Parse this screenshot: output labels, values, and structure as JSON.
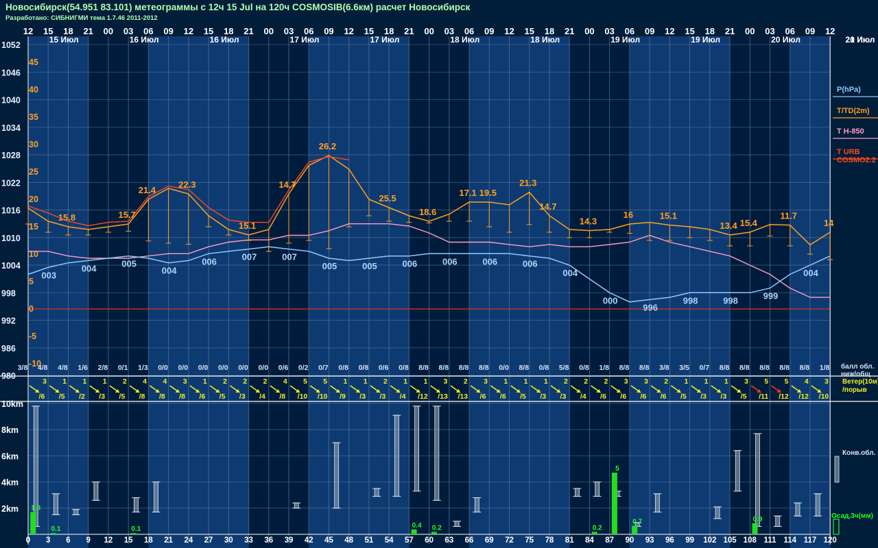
{
  "header": {
    "title": "Новосибирск(54.951 83.101) метеограммы с  12ч 15 Jul на 120ч COSMOSIB(6.6км) расчет Новосибирск",
    "subtitle": "Разработано: СИБНИГМИ тема 1.7.46 2011-2012"
  },
  "chart_data": {
    "type": "line",
    "time_axis": {
      "lead_hours": [
        0,
        3,
        6,
        9,
        12,
        15,
        18,
        21,
        24,
        27,
        30,
        33,
        36,
        39,
        42,
        45,
        48,
        51,
        54,
        57,
        60,
        63,
        66,
        69,
        72,
        75,
        78,
        81,
        84,
        87,
        90,
        93,
        96,
        99,
        102,
        105,
        108,
        111,
        114,
        117,
        120
      ],
      "top_hour_labels": [
        "12",
        "15",
        "18",
        "21",
        "00",
        "03",
        "06",
        "09",
        "12",
        "15",
        "18",
        "21",
        "00",
        "03",
        "06",
        "09",
        "12",
        "15",
        "18",
        "21",
        "00",
        "03",
        "06",
        "09",
        "12",
        "15",
        "18",
        "21",
        "00",
        "03",
        "06",
        "09",
        "12",
        "15",
        "18",
        "21",
        "00",
        "03",
        "06",
        "09",
        "12"
      ],
      "day_labels": [
        "15 Июл",
        "16 Июл",
        "16 Июл",
        "17 Июл",
        "17 Июл",
        "18 Июл",
        "18 Июл",
        "19 Июл",
        "19 Июл",
        "20 Июл",
        "20 Июл",
        "21 Июл"
      ]
    },
    "pressure_axis": {
      "label": "P(hPa)",
      "ticks": [
        1052,
        1046,
        1040,
        1034,
        1028,
        1022,
        1016,
        1010,
        1004,
        998,
        992,
        986,
        980
      ]
    },
    "temperature_axis": {
      "ticks": [
        45,
        40,
        35,
        30,
        25,
        20,
        15,
        10,
        5,
        0,
        -5,
        -10
      ]
    },
    "legend": [
      "P(hPa)",
      "T/TD(2m)",
      "T H-850",
      "T URB",
      "COSMO2.2"
    ],
    "series": [
      {
        "name": "P(hPa)",
        "color": "#8fc8ff",
        "values": [
          1002,
          1003.5,
          1004.5,
          1005,
          1005.5,
          1006,
          1005.5,
          1004.5,
          1005,
          1006.5,
          1007,
          1007.5,
          1008,
          1007.5,
          1007,
          1005.5,
          1005,
          1005.5,
          1006,
          1006,
          1006.5,
          1006.5,
          1006.5,
          1006.5,
          1006.5,
          1006,
          1005.5,
          1004,
          1001,
          998,
          996,
          996.5,
          997,
          998,
          998,
          998,
          998,
          999,
          1002,
          1004,
          1006
        ]
      },
      {
        "name": "T H-850",
        "color": "#ff9ec4",
        "values": [
          1007,
          1007,
          1006,
          1005.5,
          1005.5,
          1005.5,
          1006,
          1006.5,
          1006.5,
          1008,
          1009,
          1009.5,
          1009.5,
          1010.5,
          1010.5,
          1011.5,
          1013,
          1013,
          1013,
          1012.5,
          1011,
          1009,
          1009,
          1009,
          1008.5,
          1008,
          1008.5,
          1008,
          1008,
          1008.5,
          1009,
          1010.5,
          1009,
          1008,
          1007,
          1006,
          1004,
          1002,
          999,
          997,
          997
        ]
      },
      {
        "name": "T/TD(2m)",
        "color": "#ffa020",
        "values": [
          18.4,
          16,
          15,
          14.5,
          15,
          15.5,
          20,
          22,
          21,
          17,
          14.5,
          13.5,
          14.5,
          21,
          26.2,
          28,
          25.5,
          20,
          18.5,
          17,
          16,
          17.3,
          19.5,
          19.5,
          19,
          21.3,
          17,
          14.5,
          14.3,
          14.5,
          15.5,
          15.8,
          15.3,
          15,
          14.5,
          13.5,
          14,
          15.4,
          15.3,
          11.7,
          14
        ]
      },
      {
        "name": "T URB",
        "color": "#ff4a1a",
        "values": [
          18.8,
          17.5,
          16,
          15.2,
          15.8,
          16,
          20.5,
          22.4,
          21.8,
          18.5,
          16.2,
          15.8,
          15.8,
          21.7,
          26.8,
          27.8,
          27.2
        ]
      },
      {
        "name": "dew point (2m)",
        "color": "#ffa020",
        "values": [
          15.5,
          14,
          13.5,
          13.5,
          14,
          14.2,
          12.4,
          12,
          11.8,
          15,
          13.5,
          12.5,
          10.5,
          12,
          12.5,
          11,
          15,
          17,
          16,
          15.8,
          15.7,
          16,
          16,
          15,
          14,
          15.4,
          14,
          13,
          13,
          14,
          13.8,
          12.5,
          12.5,
          13,
          12.5,
          11.5,
          11.5,
          13.3,
          11.5,
          10,
          9
        ]
      },
      {
        "name": "COSMO2.2",
        "color": "#ff7050",
        "values": []
      }
    ],
    "temp_value_labels": [
      {
        "hour": 9,
        "text": "15.8"
      },
      {
        "hour": 18,
        "text": "15.7"
      },
      {
        "hour": 24,
        "text": "21.4"
      },
      {
        "hour": 30,
        "text": "22.3"
      },
      {
        "hour": 42,
        "text": "15.1"
      },
      {
        "hour": 51,
        "text": "14.7"
      },
      {
        "hour": 60,
        "text": "26.2"
      },
      {
        "hour": 69,
        "text": "25.5"
      },
      {
        "hour": 78,
        "text": "18.6"
      },
      {
        "hour": 84,
        "text": "17.1"
      },
      {
        "hour": 90,
        "text": "19.5"
      },
      {
        "hour": 96,
        "text": "21.3"
      },
      {
        "hour": 102,
        "text": "14.7"
      },
      {
        "hour": 111,
        "text": "14.3"
      },
      {
        "hour": 117,
        "text": "16"
      },
      {
        "hour": 126,
        "text": "15.1"
      },
      {
        "hour": 135,
        "text": "13.4"
      },
      {
        "hour": 141,
        "text": "15.4"
      },
      {
        "hour": 150,
        "text": "11.7"
      },
      {
        "hour": 156,
        "text": "14"
      }
    ],
    "pressure_value_labels": [
      {
        "hour": 3,
        "text": "003"
      },
      {
        "hour": 9,
        "text": "004"
      },
      {
        "hour": 15,
        "text": "005"
      },
      {
        "hour": 21,
        "text": "004"
      },
      {
        "hour": 27,
        "text": "006"
      },
      {
        "hour": 33,
        "text": "007"
      },
      {
        "hour": 39,
        "text": "007"
      },
      {
        "hour": 45,
        "text": "005"
      },
      {
        "hour": 51,
        "text": "005"
      },
      {
        "hour": 57,
        "text": "006"
      },
      {
        "hour": 63,
        "text": "006"
      },
      {
        "hour": 69,
        "text": "006"
      },
      {
        "hour": 75,
        "text": "006"
      },
      {
        "hour": 81,
        "text": "004"
      },
      {
        "hour": 87,
        "text": "000"
      },
      {
        "hour": 93,
        "text": "996"
      },
      {
        "hour": 99,
        "text": "998"
      },
      {
        "hour": 105,
        "text": "998"
      },
      {
        "hour": 111,
        "text": "999"
      },
      {
        "hour": 117,
        "text": "004"
      }
    ],
    "cloud_cover": {
      "label_line1": "балл обл.",
      "label_line2": "ниж/общ",
      "values": [
        "3/8",
        "4/8",
        "4/8",
        "1/6",
        "2/8",
        "0/1",
        "1/3",
        "0/0",
        "0/0",
        "0/0",
        "0/0",
        "0/0",
        "0/0",
        "0/6",
        "0/2",
        "0/7",
        "0/8",
        "0/8",
        "0/6",
        "0/8",
        "8/8",
        "8/8",
        "8/8",
        "8/8",
        "0/0",
        "8/8",
        "0/8",
        "5/8",
        "0/8",
        "1/8",
        "8/8",
        "8/8",
        "3/8",
        "3/5",
        "0/7",
        "8/8",
        "8/8",
        "8/8",
        "8/8",
        "8/8",
        "1/8"
      ]
    },
    "wind": {
      "label_line1": "Ветер(10м)",
      "label_line2": "/порыв",
      "speed": [
        "3",
        "1",
        "1",
        "1",
        "2",
        "4",
        "4",
        "3",
        "1",
        "2",
        "2",
        "2",
        "4",
        "5",
        "5",
        "1",
        "1",
        "2",
        "1",
        "1",
        "3",
        "2",
        "3",
        "1",
        "1",
        "1",
        "2",
        "2",
        "2",
        "3",
        "3",
        "2",
        "1",
        "1",
        "1",
        "3",
        "5",
        "5",
        "4",
        "3"
      ],
      "gust": [
        "/6",
        "/5",
        "/2",
        "/3",
        "/5",
        "/8",
        "/8",
        "/8",
        "/6",
        "/5",
        "/3",
        "/4",
        "/8",
        "/10",
        "/10",
        "/9",
        "/3",
        "/3",
        "/4",
        "/12",
        "/13",
        "/13",
        "/6",
        "/6",
        "/5",
        "/3",
        "/3",
        "/4",
        "/6",
        "/6",
        "/6",
        "/6",
        "/5",
        "/3",
        "/3",
        "/5",
        "/11",
        "/12",
        "/12",
        "/10"
      ],
      "colors": [
        "yellow",
        "yellow",
        "yellow",
        "yellow",
        "yellow",
        "yellow",
        "yellow",
        "yellow",
        "yellow",
        "yellow",
        "yellow",
        "yellow",
        "yellow",
        "yellow",
        "yellow",
        "yellow",
        "yellow",
        "yellow",
        "yellow",
        "yellow",
        "yellow",
        "yellow",
        "yellow",
        "yellow",
        "yellow",
        "yellow",
        "yellow",
        "yellow",
        "yellow",
        "yellow",
        "yellow",
        "yellow",
        "yellow",
        "yellow",
        "yellow",
        "yellow",
        "red",
        "red",
        "yellow",
        "yellow"
      ]
    },
    "convective_cloud": {
      "label": "Конв.обл.",
      "height_ticks": [
        "10km",
        "8km",
        "6km",
        "4km",
        "2km"
      ],
      "bars": [
        {
          "hour": 3,
          "base": 0.6,
          "top": 9.8
        },
        {
          "hour": 6,
          "base": 1.5,
          "top": 3.1
        },
        {
          "hour": 9,
          "base": 1.5,
          "top": 1.9
        },
        {
          "hour": 12,
          "base": 2.6,
          "top": 4.0
        },
        {
          "hour": 18,
          "base": 1.7,
          "top": 2.8
        },
        {
          "hour": 21,
          "base": 1.7,
          "top": 4.0
        },
        {
          "hour": 42,
          "base": 2.0,
          "top": 2.4
        },
        {
          "hour": 48,
          "base": 2.0,
          "top": 7.0
        },
        {
          "hour": 54,
          "base": 2.9,
          "top": 3.5
        },
        {
          "hour": 57,
          "base": 2.9,
          "top": 9.1
        },
        {
          "hour": 60,
          "base": 3.3,
          "top": 9.8
        },
        {
          "hour": 63,
          "base": 2.6,
          "top": 9.8
        },
        {
          "hour": 66,
          "base": 0.6,
          "top": 1.0
        },
        {
          "hour": 69,
          "base": 1.7,
          "top": 2.8
        },
        {
          "hour": 84,
          "base": 2.9,
          "top": 3.5
        },
        {
          "hour": 87,
          "base": 2.9,
          "top": 4.0
        },
        {
          "hour": 90,
          "base": 2.9,
          "top": 3.3
        },
        {
          "hour": 93,
          "base": 0.6,
          "top": 0.9
        },
        {
          "hour": 96,
          "base": 1.7,
          "top": 3.1
        },
        {
          "hour": 105,
          "base": 1.2,
          "top": 2.1
        },
        {
          "hour": 108,
          "base": 3.3,
          "top": 6.4
        },
        {
          "hour": 111,
          "base": 0.6,
          "top": 7.7
        },
        {
          "hour": 114,
          "base": 0.6,
          "top": 1.4
        },
        {
          "hour": 117,
          "base": 1.4,
          "top": 2.4
        },
        {
          "hour": 120,
          "base": 1.4,
          "top": 3.1
        }
      ]
    },
    "precipitation": {
      "label": "Осад,3ч(мм)",
      "bars": [
        {
          "hour": 3,
          "value": 1.8
        },
        {
          "hour": 6,
          "value": 0.1
        },
        {
          "hour": 18,
          "value": 0.1
        },
        {
          "hour": 60,
          "value": 0.4
        },
        {
          "hour": 63,
          "value": 0.2
        },
        {
          "hour": 87,
          "value": 0.2
        },
        {
          "hour": 90,
          "value": 5
        },
        {
          "hour": 93,
          "value": 0.7
        },
        {
          "hour": 111,
          "value": 0.9
        }
      ]
    }
  }
}
